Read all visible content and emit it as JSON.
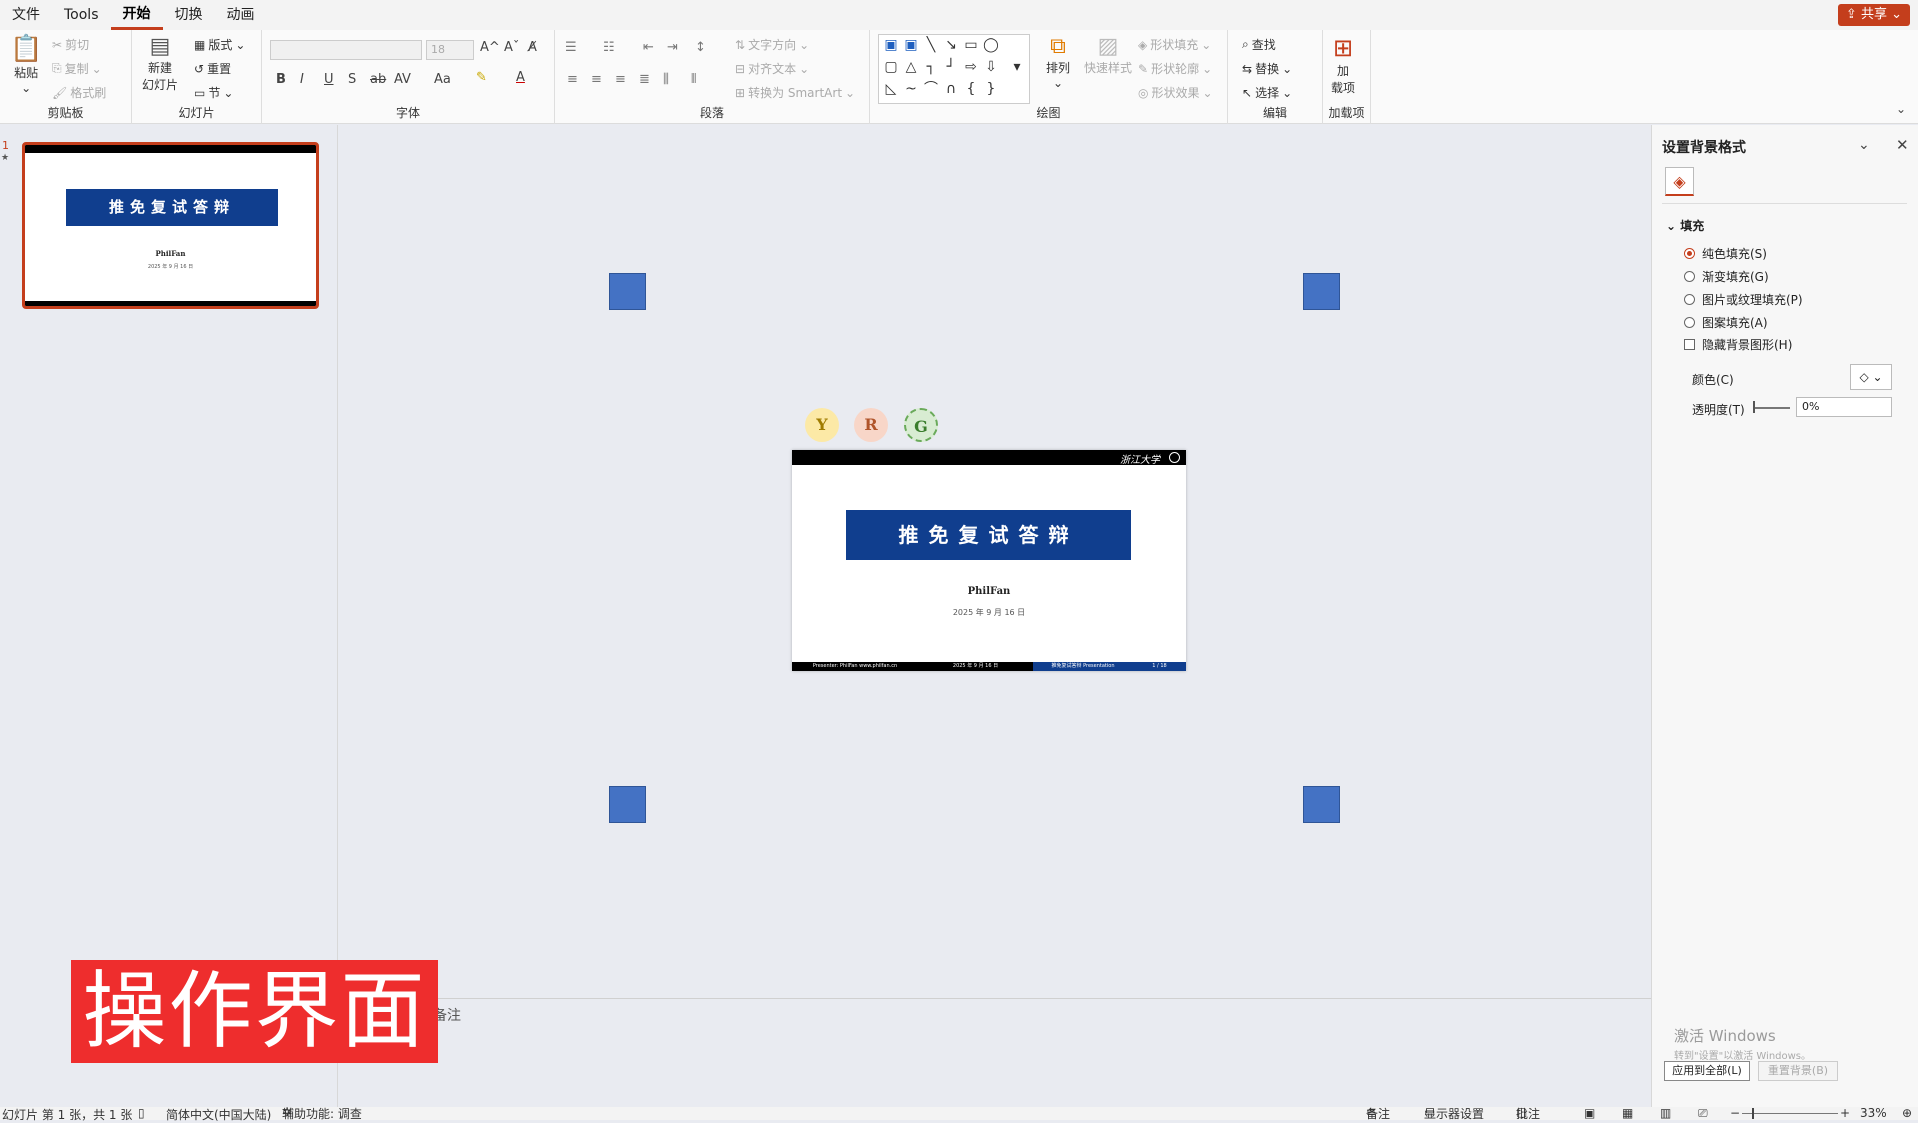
{
  "menu": {
    "items": [
      "文件",
      "Tools",
      "开始",
      "切换",
      "动画"
    ],
    "active": "开始",
    "share": "共享"
  },
  "ribbon": {
    "clipboard": {
      "paste": "粘贴",
      "cut": "剪切",
      "copy": "复制",
      "format_painter": "格式刷",
      "label": "剪贴板"
    },
    "slides": {
      "new_slide_1": "新建",
      "new_slide_2": "幻灯片",
      "layout": "版式",
      "reset": "重置",
      "section": "节",
      "label": "幻灯片"
    },
    "font": {
      "size": "18",
      "bold": "B",
      "italic": "I",
      "underline": "U",
      "strike": "S",
      "spacing": "AV",
      "case": "Aa",
      "grow": "A^",
      "shrink": "Aˇ",
      "label": "字体"
    },
    "paragraph": {
      "text_direction": "文字方向",
      "align_text": "对齐文本",
      "convert_smartart": "转换为 SmartArt",
      "label": "段落"
    },
    "drawing": {
      "arrange": "排列",
      "quick_styles": "快速样式",
      "shape_fill": "形状填充",
      "shape_outline": "形状轮廓",
      "shape_effects": "形状效果",
      "label": "绘图"
    },
    "editing": {
      "find": "查找",
      "replace": "替换",
      "select": "选择",
      "label": "编辑"
    },
    "addins": {
      "addins_1": "加",
      "addins_2": "载项",
      "label": "加载项"
    }
  },
  "thumbnail": {
    "number": "1",
    "star": "★"
  },
  "slide": {
    "title": "推免复试答辩",
    "author": "PhilFan",
    "date": "2025 年 9 月 16 日",
    "logo": "浙江大学",
    "footer_left": "Presenter: PhilFan www.philfan.cn",
    "footer_mid": "2025 年 9 月 16 日",
    "footer_right": "推免复试答辩 Presentation",
    "page": "1 / 18"
  },
  "badges": [
    "Y",
    "R",
    "G"
  ],
  "notes": "备注",
  "stamp": "操作界面",
  "format_pane": {
    "title": "设置背景格式",
    "section": "填充",
    "options": [
      "纯色填充(S)",
      "渐变填充(G)",
      "图片或纹理填充(P)",
      "图案填充(A)"
    ],
    "selected": "纯色填充(S)",
    "hide_bg": "隐藏背景图形(H)",
    "color_label": "颜色(C)",
    "transparency_label": "透明度(T)",
    "transparency_value": "0%",
    "apply_all": "应用到全部(L)",
    "reset_bg": "重置背景(B)",
    "watermark_1": "激活 Windows",
    "watermark_2": "转到\"设置\"以激活 Windows。"
  },
  "status": {
    "slide_info": "幻灯片 第 1 张，共 1 张",
    "language": "简体中文(中国大陆)",
    "accessibility": "辅助功能: 调查",
    "notes": "备注",
    "display": "显示器设置",
    "comments": "批注",
    "zoom": "33%"
  },
  "colors": {
    "accent": "#c43e1c",
    "banner": "#103e8e",
    "handle": "#4472c4",
    "stamp": "#ee2d2d"
  }
}
